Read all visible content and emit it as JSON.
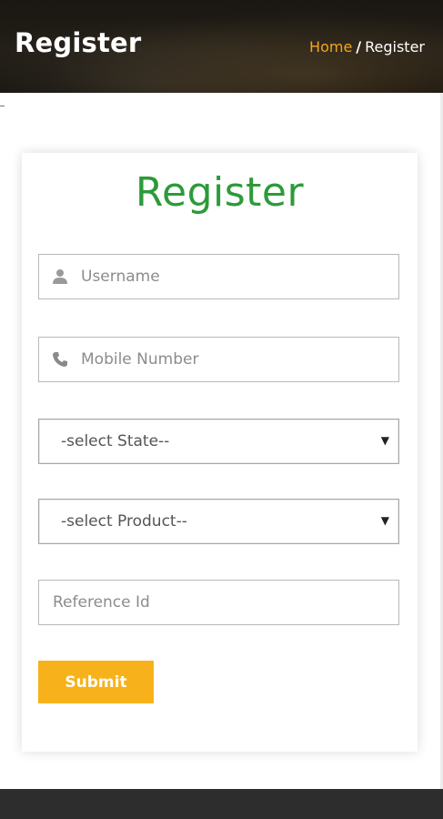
{
  "header": {
    "title": "Register",
    "breadcrumb": {
      "home": "Home",
      "separator": "/",
      "current": "Register"
    }
  },
  "form": {
    "title": "Register",
    "username": {
      "placeholder": "Username",
      "icon": "user-icon"
    },
    "mobile": {
      "placeholder": "Mobile Number",
      "icon": "phone-icon"
    },
    "state_select": {
      "selected": "-select State--"
    },
    "product_select": {
      "selected": "-select Product--"
    },
    "reference": {
      "placeholder": "Reference Id"
    },
    "submit_label": "Submit"
  },
  "colors": {
    "accent": "#f7b21b",
    "breadcrumb_home": "#f3a61b",
    "form_title": "#2c9a3a",
    "footer": "#2d2d2d"
  }
}
